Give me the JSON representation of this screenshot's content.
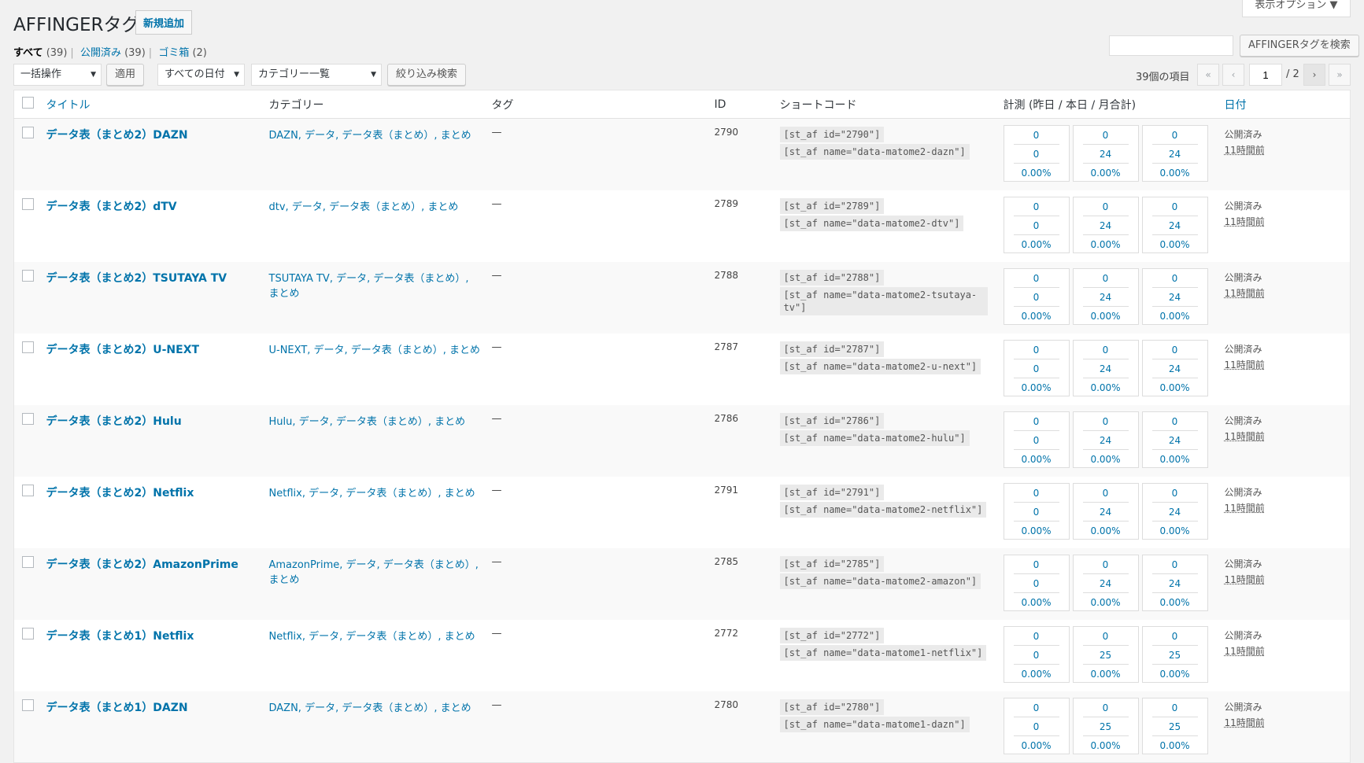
{
  "header": {
    "title": "AFFINGERタグ",
    "add_new": "新規追加",
    "screen_options": "表示オプション ▼"
  },
  "views": {
    "all": "すべて",
    "all_count": "(39)",
    "published": "公開済み",
    "published_count": "(39)",
    "trash": "ゴミ箱",
    "trash_count": "(2)"
  },
  "toolbar": {
    "bulk": "一括操作",
    "apply": "適用",
    "dates": "すべての日付",
    "categories": "カテゴリー一覧",
    "filter": "絞り込み検索",
    "search_button": "AFFINGERタグを検索",
    "search_value": "",
    "items": "39個の項目",
    "page": "1",
    "total_pages": "/ 2",
    "first": "«",
    "prev": "‹",
    "next": "›",
    "last": "»"
  },
  "columns": {
    "title": "タイトル",
    "category": "カテゴリー",
    "tag": "タグ",
    "id": "ID",
    "shortcode": "ショートコード",
    "metrics": "計測 (昨日 / 本日 / 月合計)",
    "date": "日付"
  },
  "rows": [
    {
      "title": "データ表（まとめ2）DAZN",
      "category": "DAZN, データ, データ表（まとめ）, まとめ",
      "tag": "—",
      "id": "2790",
      "code1": "[st_af id=\"2790\"]",
      "code2": "[st_af name=\"data-matome2-dazn\"]",
      "m": [
        [
          "0",
          "0",
          "0.00%"
        ],
        [
          "0",
          "24",
          "0.00%"
        ],
        [
          "0",
          "24",
          "0.00%"
        ]
      ],
      "status": "公開済み",
      "time": "11時間前"
    },
    {
      "title": "データ表（まとめ2）dTV",
      "category": "dtv, データ, データ表（まとめ）, まとめ",
      "tag": "—",
      "id": "2789",
      "code1": "[st_af id=\"2789\"]",
      "code2": "[st_af name=\"data-matome2-dtv\"]",
      "m": [
        [
          "0",
          "0",
          "0.00%"
        ],
        [
          "0",
          "24",
          "0.00%"
        ],
        [
          "0",
          "24",
          "0.00%"
        ]
      ],
      "status": "公開済み",
      "time": "11時間前"
    },
    {
      "title": "データ表（まとめ2）TSUTAYA TV",
      "category": "TSUTAYA TV, データ, データ表（まとめ）, まとめ",
      "tag": "—",
      "id": "2788",
      "code1": "[st_af id=\"2788\"]",
      "code2": "[st_af name=\"data-matome2-tsutaya-tv\"]",
      "m": [
        [
          "0",
          "0",
          "0.00%"
        ],
        [
          "0",
          "24",
          "0.00%"
        ],
        [
          "0",
          "24",
          "0.00%"
        ]
      ],
      "status": "公開済み",
      "time": "11時間前"
    },
    {
      "title": "データ表（まとめ2）U-NEXT",
      "category": "U-NEXT, データ, データ表（まとめ）, まとめ",
      "tag": "—",
      "id": "2787",
      "code1": "[st_af id=\"2787\"]",
      "code2": "[st_af name=\"data-matome2-u-next\"]",
      "m": [
        [
          "0",
          "0",
          "0.00%"
        ],
        [
          "0",
          "24",
          "0.00%"
        ],
        [
          "0",
          "24",
          "0.00%"
        ]
      ],
      "status": "公開済み",
      "time": "11時間前"
    },
    {
      "title": "データ表（まとめ2）Hulu",
      "category": "Hulu, データ, データ表（まとめ）, まとめ",
      "tag": "—",
      "id": "2786",
      "code1": "[st_af id=\"2786\"]",
      "code2": "[st_af name=\"data-matome2-hulu\"]",
      "m": [
        [
          "0",
          "0",
          "0.00%"
        ],
        [
          "0",
          "24",
          "0.00%"
        ],
        [
          "0",
          "24",
          "0.00%"
        ]
      ],
      "status": "公開済み",
      "time": "11時間前"
    },
    {
      "title": "データ表（まとめ2）Netflix",
      "category": "Netflix, データ, データ表（まとめ）, まとめ",
      "tag": "—",
      "id": "2791",
      "code1": "[st_af id=\"2791\"]",
      "code2": "[st_af name=\"data-matome2-netflix\"]",
      "m": [
        [
          "0",
          "0",
          "0.00%"
        ],
        [
          "0",
          "24",
          "0.00%"
        ],
        [
          "0",
          "24",
          "0.00%"
        ]
      ],
      "status": "公開済み",
      "time": "11時間前"
    },
    {
      "title": "データ表（まとめ2）AmazonPrime",
      "category": "AmazonPrime, データ, データ表（まとめ）, まとめ",
      "tag": "—",
      "id": "2785",
      "code1": "[st_af id=\"2785\"]",
      "code2": "[st_af name=\"data-matome2-amazon\"]",
      "m": [
        [
          "0",
          "0",
          "0.00%"
        ],
        [
          "0",
          "24",
          "0.00%"
        ],
        [
          "0",
          "24",
          "0.00%"
        ]
      ],
      "status": "公開済み",
      "time": "11時間前"
    },
    {
      "title": "データ表（まとめ1）Netflix",
      "category": "Netflix, データ, データ表（まとめ）, まとめ",
      "tag": "—",
      "id": "2772",
      "code1": "[st_af id=\"2772\"]",
      "code2": "[st_af name=\"data-matome1-netflix\"]",
      "m": [
        [
          "0",
          "0",
          "0.00%"
        ],
        [
          "0",
          "25",
          "0.00%"
        ],
        [
          "0",
          "25",
          "0.00%"
        ]
      ],
      "status": "公開済み",
      "time": "11時間前"
    },
    {
      "title": "データ表（まとめ1）DAZN",
      "category": "DAZN, データ, データ表（まとめ）, まとめ",
      "tag": "—",
      "id": "2780",
      "code1": "[st_af id=\"2780\"]",
      "code2": "[st_af name=\"data-matome1-dazn\"]",
      "m": [
        [
          "0",
          "0",
          "0.00%"
        ],
        [
          "0",
          "25",
          "0.00%"
        ],
        [
          "0",
          "25",
          "0.00%"
        ]
      ],
      "status": "公開済み",
      "time": "11時間前"
    }
  ]
}
